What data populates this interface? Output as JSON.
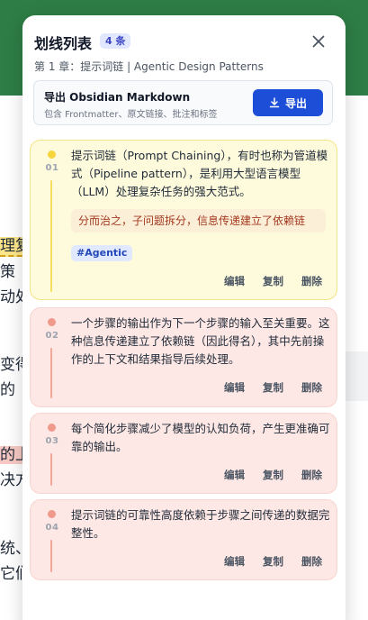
{
  "background": {
    "lines": [
      "理复",
      "策",
      "动处",
      "变得",
      "的",
      "的上",
      "决方",
      "统、",
      "它们"
    ]
  },
  "panel": {
    "title": "划线列表",
    "count": "4 条",
    "subtitle": "第 1 章：提示词链 | Agentic Design Patterns",
    "close_icon": "close-icon"
  },
  "export": {
    "title": "导出 Obsidian Markdown",
    "description": "包含 Frontmatter、原文链接、批注和标签",
    "button_label": "导出",
    "button_icon": "download-icon",
    "accent": "#1d4ed8"
  },
  "highlights": [
    {
      "number": "01",
      "color": "yellow",
      "text": "提示词链（Prompt Chaining），有时也称为管道模式（Pipeline pattern），是利用大型语言模型（LLM）处理复杂任务的强大范式。",
      "note": "分而治之，子问题拆分，信息传递建立了依赖链",
      "tag": "#Agentic"
    },
    {
      "number": "02",
      "color": "red",
      "text": "一个步骤的输出作为下一个步骤的输入至关重要。这种信息传递建立了依赖链（因此得名），其中先前操作的上下文和结果指导后续处理。"
    },
    {
      "number": "03",
      "color": "red",
      "text": "每个简化步骤减少了模型的认知负荷，产生更准确可靠的输出。"
    },
    {
      "number": "04",
      "color": "red",
      "text": "提示词链的可靠性高度依赖于步骤之间传递的数据完整性。"
    }
  ],
  "actions": {
    "edit": "编辑",
    "copy": "复制",
    "delete": "删除"
  }
}
